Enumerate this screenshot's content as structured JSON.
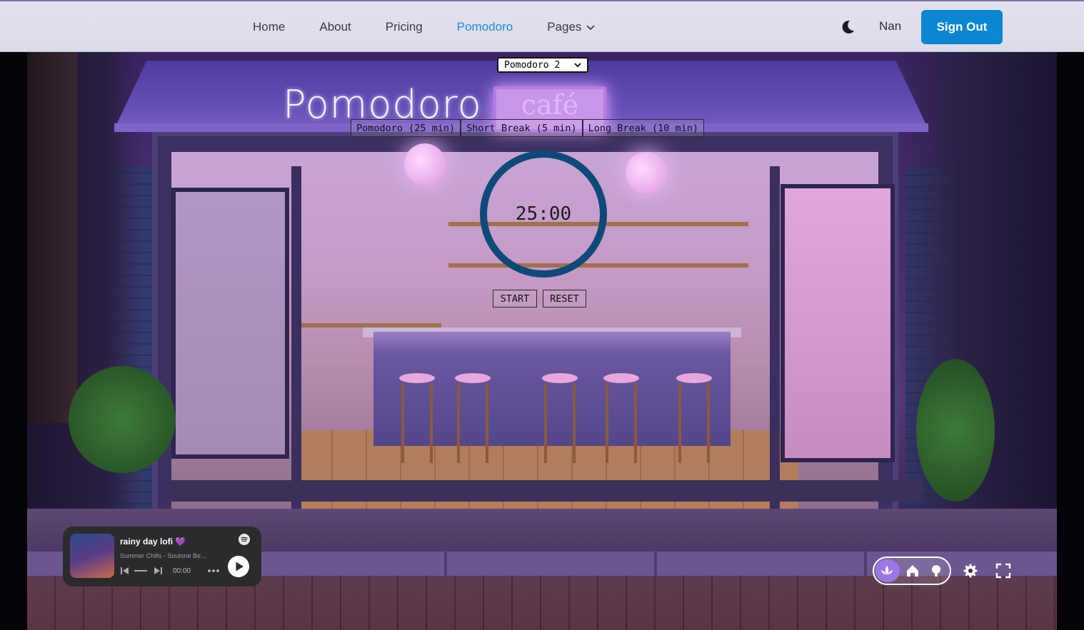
{
  "nav": {
    "items": [
      {
        "label": "Home",
        "active": false
      },
      {
        "label": "About",
        "active": false
      },
      {
        "label": "Pricing",
        "active": false
      },
      {
        "label": "Pomodoro",
        "active": true
      },
      {
        "label": "Pages",
        "active": false,
        "has_dropdown": true
      }
    ],
    "theme_icon": "moon-icon",
    "username": "Nan",
    "signout_label": "Sign Out"
  },
  "colors": {
    "accent": "#1f8fd6",
    "signout_bg": "#0b86d0",
    "timer_ring": "#0d4a7a"
  },
  "pomodoro": {
    "preset_selected": "Pomodoro 2",
    "modes": [
      {
        "label": "Pomodoro (25 min)"
      },
      {
        "label": "Short Break (5 min)"
      },
      {
        "label": "Long Break (10 min)"
      }
    ],
    "timer": "25:00",
    "start_label": "START",
    "reset_label": "RESET"
  },
  "scene": {
    "sign_title": "Pomodoro",
    "sign_cafe": "café"
  },
  "player": {
    "title": "rainy day lofi 💜",
    "subtitle": "Summer Chills - Soulone Be...",
    "time": "00:00"
  },
  "toolbar": {
    "icons": [
      "lotus-icon",
      "home-icon",
      "lightbulb-icon",
      "gear-icon",
      "fullscreen-icon"
    ]
  }
}
